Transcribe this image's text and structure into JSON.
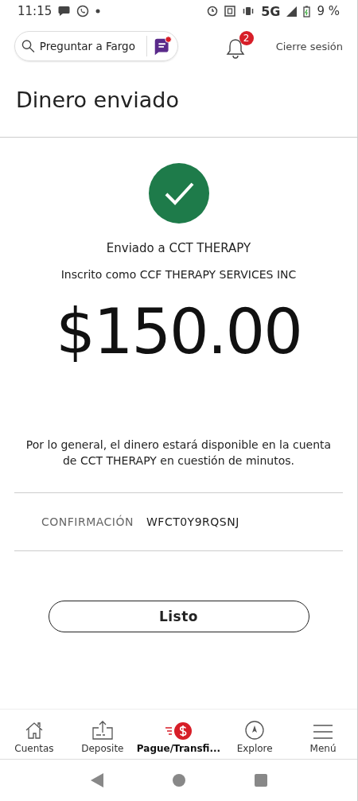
{
  "status_bar": {
    "time": "11:15",
    "network": "5G",
    "battery": "9 %"
  },
  "header": {
    "search": {
      "placeholder": "Preguntar a Fargo"
    },
    "notifications": {
      "count": "2"
    },
    "logout": "Cierre sesión"
  },
  "page_title": "Dinero enviado",
  "receipt": {
    "recipient": "Enviado a CCT THERAPY",
    "enrolled_as": "Inscrito como CCF THERAPY SERVICES INC",
    "amount": "$150.00",
    "note": "Por lo general, el dinero estará disponible en la cuenta de CCT THERAPY en cuestión de minutos.",
    "confirmation": {
      "label": "CONFIRMACIÓN",
      "value": "WFCT0Y9RQSNJ"
    }
  },
  "done_button": "Listo",
  "bottom_nav": [
    {
      "label": "Cuentas",
      "kind": "home",
      "selected": false
    },
    {
      "label": "Deposite",
      "kind": "deposit",
      "selected": false
    },
    {
      "label": "Pague/Transfi...",
      "kind": "pay",
      "selected": true
    },
    {
      "label": "Explore",
      "kind": "explore",
      "selected": false
    },
    {
      "label": "Menú",
      "kind": "menu",
      "selected": false
    }
  ]
}
